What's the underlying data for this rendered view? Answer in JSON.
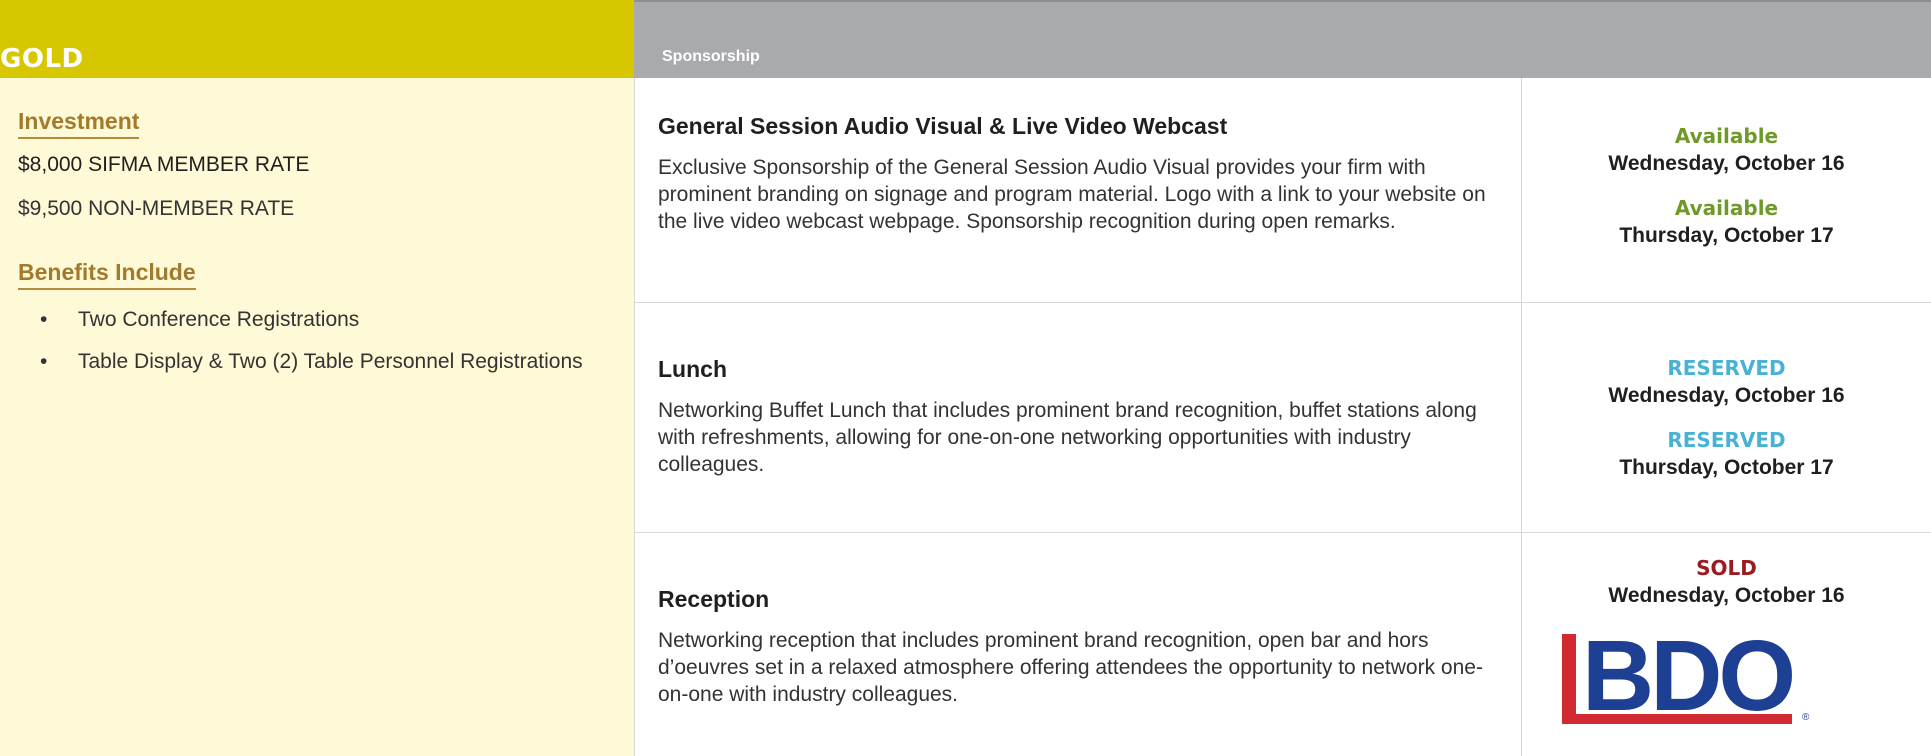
{
  "left": {
    "tier": "GOLD",
    "investment_heading": "Investment",
    "member_rate": "$8,000 SIFMA MEMBER RATE",
    "non_member_rate": "$9,500 NON-MEMBER RATE",
    "benefits_heading": "Benefits Include",
    "benefits": [
      "Two Conference Registrations",
      "Table Display & Two (2) Table Personnel Registrations"
    ],
    "bullet": "•"
  },
  "header": {
    "sponsorship_label": "Sponsorship"
  },
  "items": [
    {
      "title": "General Session Audio Visual & Live Video Webcast",
      "description": "Exclusive Sponsorship of the General Session Audio Visual provides your firm with prominent branding on signage and program material. Logo with a link to your website on the live video webcast webpage. Sponsorship recognition during open remarks.",
      "slots": [
        {
          "status": "Available",
          "day": "Wednesday, October 16"
        },
        {
          "status": "Available",
          "day": "Thursday, October 17"
        }
      ]
    },
    {
      "title": "Lunch",
      "description": "Networking Buffet Lunch that includes prominent brand recognition, buffet stations along with refreshments, allowing for one-on-one networking opportunities with industry colleagues.",
      "slots": [
        {
          "status": "RESERVED",
          "day": "Wednesday, October 16"
        },
        {
          "status": "RESERVED",
          "day": "Thursday, October 17"
        }
      ]
    },
    {
      "title": "Reception",
      "description": "Networking reception that includes prominent brand recognition, open bar and hors d’oeuvres set in a relaxed atmosphere offering attendees the opportunity to network one-on-one with industry colleagues.",
      "slots": [
        {
          "status": "SOLD",
          "day": "Wednesday, October 16"
        }
      ],
      "sponsor_logo": {
        "text": "BDO",
        "registered": "®"
      }
    }
  ],
  "colors": {
    "gold": "#d6c700",
    "available": "#6f9a2a",
    "reserved": "#48b2d4",
    "sold": "#9b1b20",
    "bdo_blue": "#1d3f94",
    "bdo_red": "#d22a33"
  }
}
